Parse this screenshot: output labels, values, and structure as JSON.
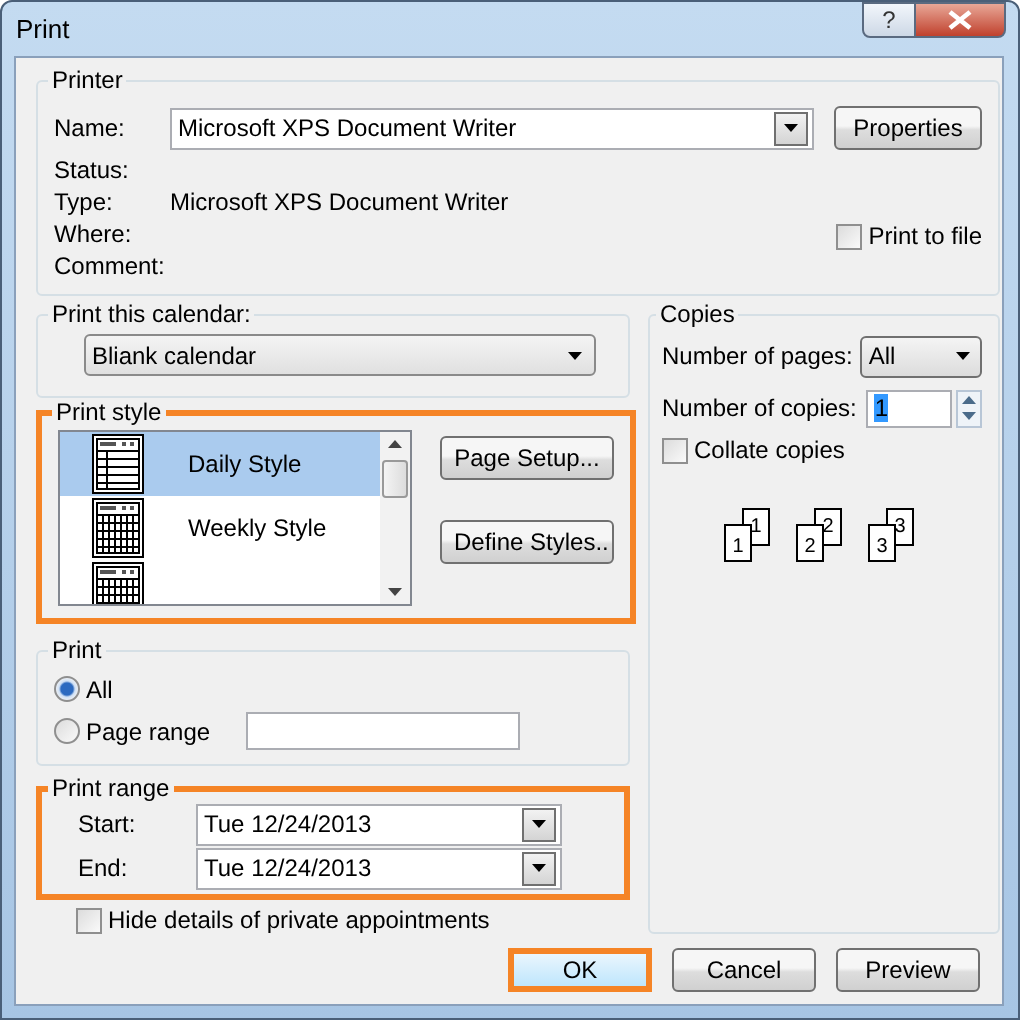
{
  "window": {
    "title": "Print",
    "help_button": "?"
  },
  "printer": {
    "legend": "Printer",
    "name_label": "Name:",
    "name_value": "Microsoft XPS Document Writer",
    "properties_button": "Properties",
    "status_label": "Status:",
    "type_label": "Type:",
    "type_value": "Microsoft XPS Document Writer",
    "where_label": "Where:",
    "comment_label": "Comment:",
    "print_to_file": {
      "label": "Print to file",
      "checked": false
    }
  },
  "calendar": {
    "legend": "Print this calendar:",
    "value": "Bliank calendar"
  },
  "print_style": {
    "legend": "Print style",
    "highlighted": true,
    "items": [
      {
        "kind": "daily",
        "label": "Daily Style",
        "selected": true
      },
      {
        "kind": "weekly",
        "label": "Weekly Style",
        "selected": false
      },
      {
        "kind": "monthly",
        "selected": false
      }
    ],
    "buttons": [
      "Page Setup...",
      "Define Styles.."
    ]
  },
  "print": {
    "legend": "Print",
    "options": [
      {
        "label": "All",
        "selected": true
      },
      {
        "label": "Page range",
        "selected": false
      }
    ]
  },
  "print_range": {
    "legend": "Print range",
    "highlighted": true,
    "start_label": "Start:",
    "start_value": "Tue 12/24/2013",
    "end_label": "End:",
    "end_value": "Tue 12/24/2013"
  },
  "hide_private": {
    "label": "Hide details of private appointments",
    "checked": false
  },
  "copies": {
    "legend": "Copies",
    "pages_label": "Number of pages:",
    "pages_value": "All",
    "copies_label": "Number of copies:",
    "copies_value": "1",
    "collate": {
      "label": "Collate copies",
      "checked": false
    },
    "collate_sets": [
      {
        "front": "1",
        "back": "1"
      },
      {
        "front": "2",
        "back": "2"
      },
      {
        "front": "3",
        "back": "3"
      }
    ]
  },
  "buttons": [
    {
      "label": "OK",
      "highlighted": true
    },
    {
      "label": "Cancel",
      "highlighted": false
    },
    {
      "label": "Preview",
      "highlighted": false
    }
  ]
}
